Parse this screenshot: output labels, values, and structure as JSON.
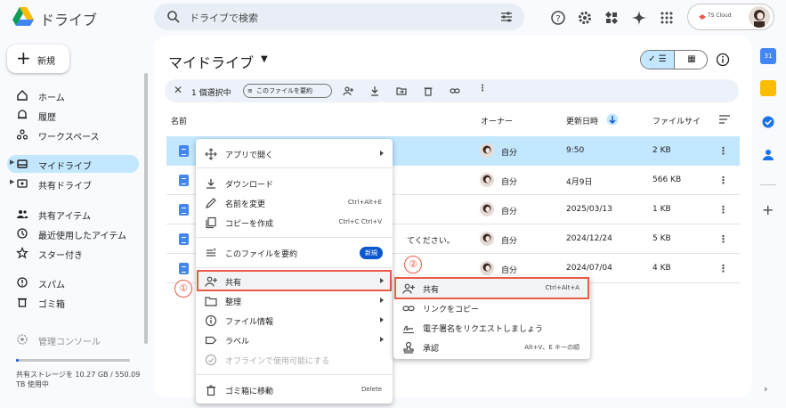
{
  "app": {
    "name": "ドライブ"
  },
  "search": {
    "placeholder": "ドライブで検索"
  },
  "account": {
    "label": "TS Cloud"
  },
  "sidebar": {
    "new_label": "新規",
    "items": [
      {
        "label": "ホーム",
        "icon": "home-icon"
      },
      {
        "label": "履歴",
        "icon": "bell-icon"
      },
      {
        "label": "ワークスペース",
        "icon": "workspaces-icon"
      },
      {
        "label": "マイドライブ",
        "icon": "drive-icon",
        "active": true
      },
      {
        "label": "共有ドライブ",
        "icon": "shared-drive-icon"
      },
      {
        "label": "共有アイテム",
        "icon": "people-icon"
      },
      {
        "label": "最近使用したアイテム",
        "icon": "clock-icon"
      },
      {
        "label": "スター付き",
        "icon": "star-icon"
      },
      {
        "label": "スパム",
        "icon": "spam-icon"
      },
      {
        "label": "ゴミ箱",
        "icon": "trash-icon"
      },
      {
        "label": "管理コンソール",
        "icon": "admin-icon"
      }
    ],
    "storage_text": "共有ストレージを 10.27 GB / 550.09 TB 使用中",
    "storage_fraction": 0.02
  },
  "main": {
    "title": "マイドライブ",
    "selection": {
      "count_label": "1 個選択中",
      "summary_label": "このファイルを要約"
    },
    "columns": {
      "name": "名前",
      "owner": "オーナー",
      "modified": "更新日時",
      "size": "ファイルサイ"
    },
    "rows": [
      {
        "name": "",
        "owner": "自分",
        "date": "9:50",
        "size": "2 KB",
        "selected": true
      },
      {
        "name": "",
        "owner": "自分",
        "date": "4月9日",
        "size": "566 KB"
      },
      {
        "name": "",
        "owner": "自分",
        "date": "2025/03/13",
        "size": "1 KB"
      },
      {
        "name": "てください。",
        "owner": "自分",
        "date": "2024/12/24",
        "size": "5 KB"
      },
      {
        "name": "",
        "owner": "自分",
        "date": "2024/07/04",
        "size": "4 KB"
      }
    ]
  },
  "context_menu": {
    "open_with": "アプリで開く",
    "download": "ダウンロード",
    "rename": "名前を変更",
    "rename_shortcut": "Ctrl+Alt+E",
    "copy": "コピーを作成",
    "copy_shortcut": "Ctrl+C Ctrl+V",
    "summarize": "このファイルを要約",
    "new_badge": "新規",
    "share": "共有",
    "organize": "整理",
    "file_info": "ファイル情報",
    "label": "ラベル",
    "offline": "オフラインで使用可能にする",
    "trash": "ゴミ箱に移動",
    "trash_shortcut": "Delete"
  },
  "submenu": {
    "share": "共有",
    "share_shortcut": "Ctrl+Alt+A",
    "copy_link": "リンクをコピー",
    "esign": "電子署名をリクエストしましょう",
    "approve": "承認",
    "approve_shortcut": "Alt+V、E キーの順"
  },
  "callouts": {
    "one": "①",
    "two": "②"
  },
  "colors": {
    "accent": "#0b57d0",
    "selected": "#c2e7ff",
    "highlight": "#ea5a47"
  }
}
